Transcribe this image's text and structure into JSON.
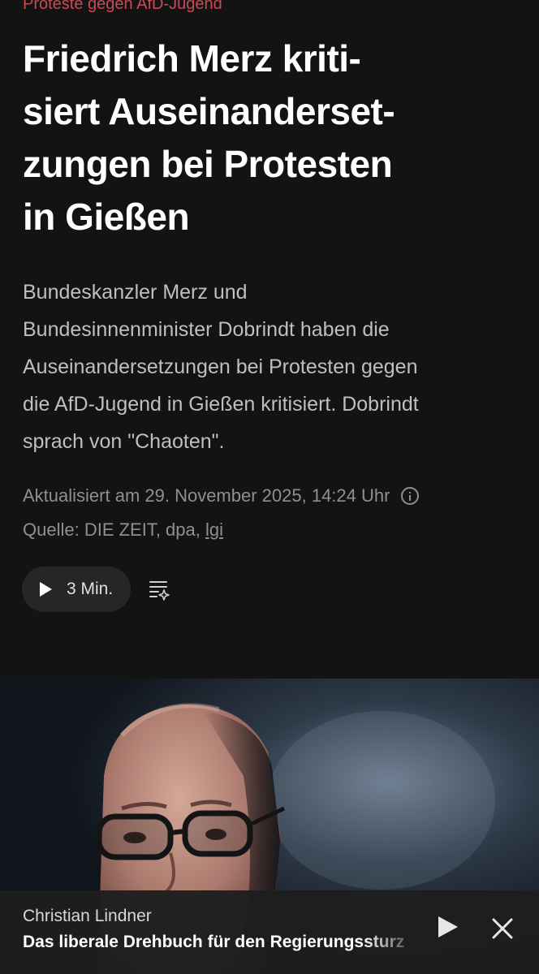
{
  "article": {
    "kicker": "Proteste gegen AfD-Jugend",
    "headline_lines": [
      "Friedrich Merz kriti-",
      "siert Auseinanderset-",
      "zungen bei Protesten",
      "in Gießen"
    ],
    "lead_lines": [
      "Bundeskanzler Merz und",
      "Bundesinnenminister Dobrindt haben die",
      "Auseinandersetzungen bei Protesten gegen",
      "die AfD-Jugend in Gießen kritisiert. Dobrindt",
      "sprach von \"Chaoten\"."
    ],
    "updated": "Aktualisiert am 29. November 2025, 14:24 Uhr",
    "source_prefix": "Quelle: DIE ZEIT, dpa, ",
    "source_link": "lgi"
  },
  "audio": {
    "duration_label": "3 Min.",
    "play_icon": "play-icon",
    "summary_icon": "ai-summary-icon"
  },
  "player": {
    "author": "Christian Lindner",
    "title": "Das liberale Drehbuch für den Regierungssturz",
    "play_icon": "play-icon",
    "close_icon": "close-icon"
  },
  "colors": {
    "background": "#131313",
    "kicker": "#c94a55",
    "lead_text": "#bfbfbf",
    "meta_text": "#8f8f8f",
    "pill": "#262626"
  }
}
